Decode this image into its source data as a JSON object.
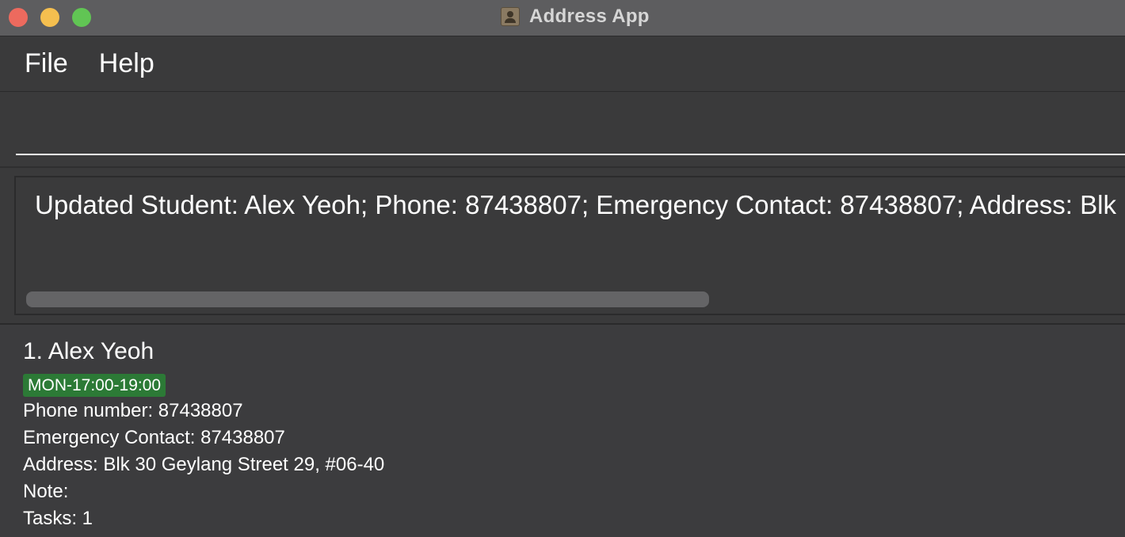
{
  "window": {
    "title": "Address App"
  },
  "menu": {
    "items": [
      "File",
      "Help"
    ]
  },
  "command_box": {
    "value": "",
    "placeholder": ""
  },
  "result_display": {
    "text": "Updated Student: Alex Yeoh; Phone: 87438807; Emergency Contact: 87438807; Address: Blk"
  },
  "persons": [
    {
      "name": "1. Alex Yeoh",
      "tag": "MON-17:00-19:00",
      "phone": "Phone number: 87438807",
      "emergency": "Emergency Contact: 87438807",
      "address": "Address: Blk 30 Geylang Street 29, #06-40",
      "note": "Note:",
      "tasks": "Tasks: 1"
    }
  ],
  "colors": {
    "titlebar": "#5d5d5f",
    "background": "#3b3c3e",
    "tag": "#2c7a36",
    "close": "#ed6a5e",
    "minimize": "#f5bf4f",
    "maximize": "#61c554"
  },
  "icons": {
    "app": "address-book-icon"
  }
}
